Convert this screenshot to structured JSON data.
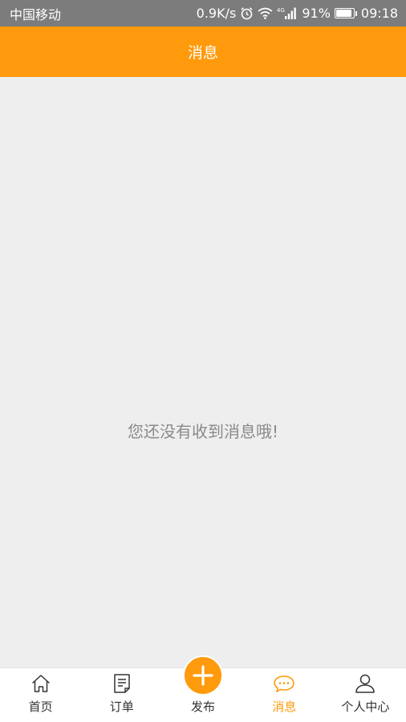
{
  "status_bar": {
    "carrier": "中国移动",
    "speed": "0.9K/s",
    "battery": "91%",
    "battery_level": 0.91,
    "time": "09:18",
    "network": "4G"
  },
  "header": {
    "title": "消息"
  },
  "main": {
    "empty_message": "您还没有收到消息哦!"
  },
  "tabs": [
    {
      "label": "首页",
      "icon": "home-icon"
    },
    {
      "label": "订单",
      "icon": "order-icon"
    },
    {
      "label": "发布",
      "icon": "plus-icon"
    },
    {
      "label": "消息",
      "icon": "message-icon",
      "active": true
    },
    {
      "label": "个人中心",
      "icon": "user-icon"
    }
  ],
  "colors": {
    "accent": "#ff9a0c",
    "status_bar": "#7c7c7c",
    "background": "#eeeeee",
    "text_muted": "#8a8a8a"
  }
}
